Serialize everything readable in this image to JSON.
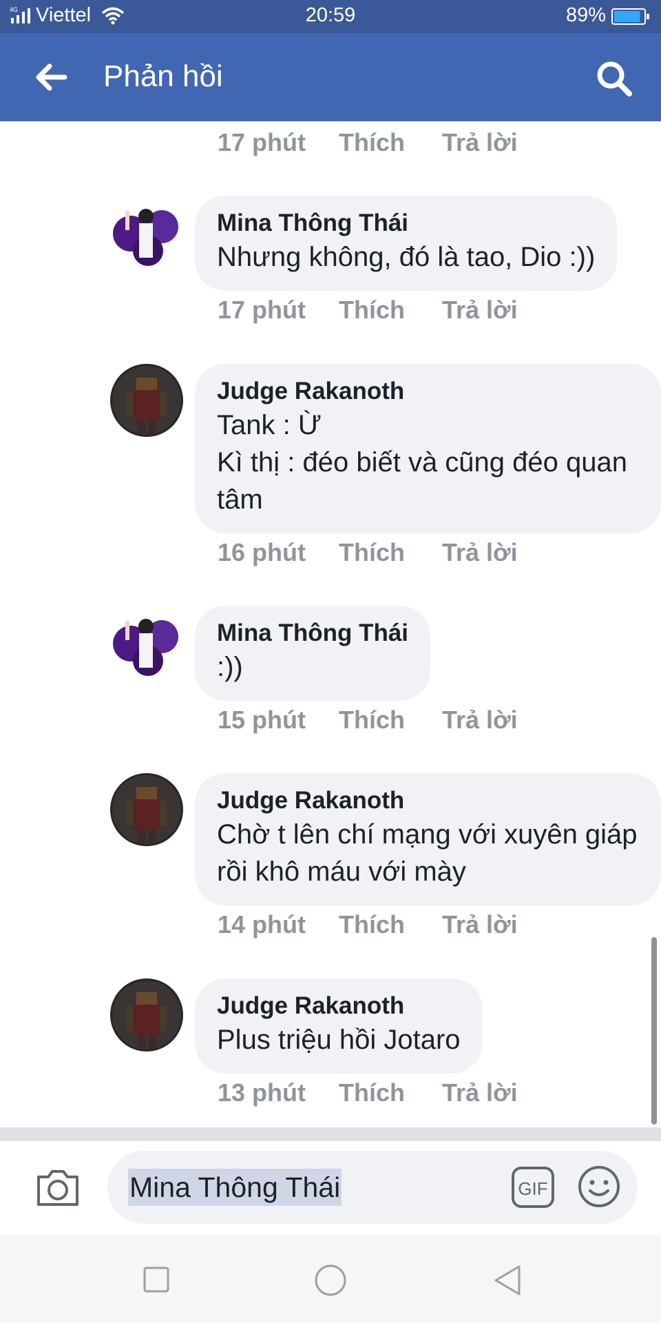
{
  "status_bar": {
    "network": "4G",
    "carrier": "Viettel",
    "time": "20:59",
    "battery_percent": "89%",
    "battery_level": 0.89
  },
  "header": {
    "title": "Phản hồi",
    "back_icon": "arrow-left-icon",
    "search_icon": "search-icon",
    "background": "#4267b2"
  },
  "top_actions": {
    "time": "17 phút",
    "like": "Thích",
    "reply": "Trả lời"
  },
  "comments": [
    {
      "author": "Mina Thông Thái",
      "text": "Nhưng không, đó là tao, Dio :))",
      "time": "17 phút",
      "like": "Thích",
      "reply": "Trả lời",
      "avatar": "avatar-purple"
    },
    {
      "author": "Judge Rakanoth",
      "text": "Tank : Ừ\nKì thị : đéo biết và cũng đéo quan tâm",
      "time": "16 phút",
      "like": "Thích",
      "reply": "Trả lời",
      "avatar": "avatar-dark"
    },
    {
      "author": "Mina Thông Thái",
      "text": ":))",
      "time": "15 phút",
      "like": "Thích",
      "reply": "Trả lời",
      "avatar": "avatar-purple"
    },
    {
      "author": "Judge Rakanoth",
      "text": "Chờ t lên chí mạng với xuyên giáp rồi khô máu với mày",
      "time": "14 phút",
      "like": "Thích",
      "reply": "Trả lời",
      "avatar": "avatar-dark"
    },
    {
      "author": "Judge Rakanoth",
      "text": "Plus triệu hồi Jotaro",
      "time": "13 phút",
      "like": "Thích",
      "reply": "Trả lời",
      "avatar": "avatar-dark"
    }
  ],
  "composer": {
    "input_value": "Mina Thông Thái",
    "camera_icon": "camera-icon",
    "gif_label": "GIF",
    "emoji_icon": "smiley-icon"
  },
  "nav_bar": {
    "recent_icon": "square-icon",
    "home_icon": "circle-icon",
    "back_icon": "triangle-back-icon"
  }
}
